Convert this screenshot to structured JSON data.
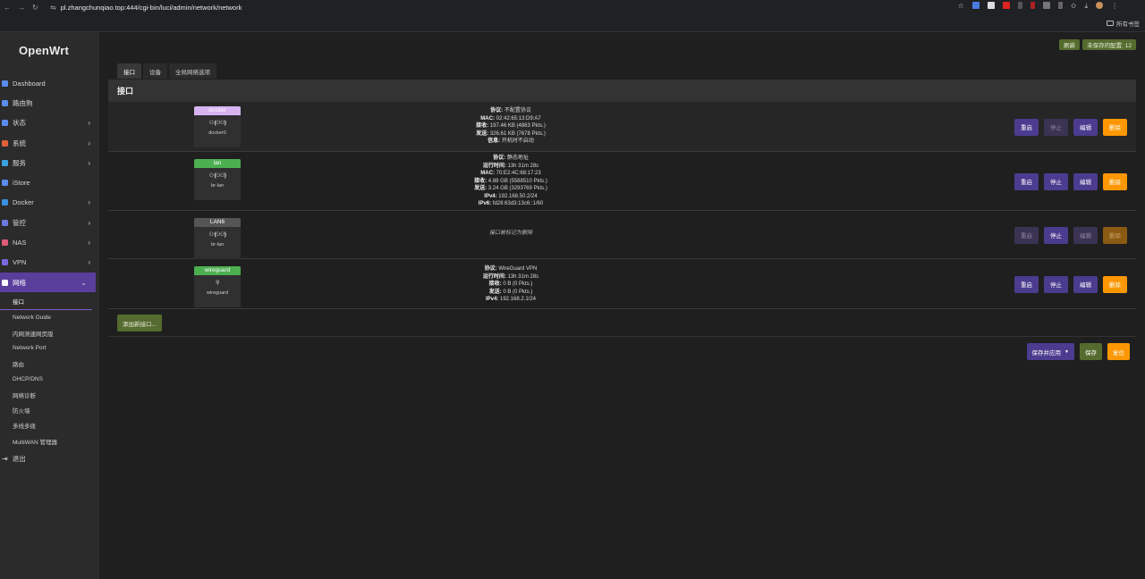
{
  "browser": {
    "url": "pl.zhangchunqiao.top:444/cgi-bin/luci/admin/network/network",
    "all_bookmarks": "所有书签"
  },
  "app": {
    "logo": "OpenWrt"
  },
  "sidebar": {
    "items": [
      {
        "label": "Dashboard",
        "icon": "dashboard-icon",
        "color": "#5b8def",
        "chevron": false
      },
      {
        "label": "路由狗",
        "icon": "dog-icon",
        "color": "#5b8def",
        "chevron": false
      },
      {
        "label": "状态",
        "icon": "status-icon",
        "color": "#5b8def",
        "chevron": true
      },
      {
        "label": "系统",
        "icon": "system-icon",
        "color": "#e0603a",
        "chevron": true
      },
      {
        "label": "服务",
        "icon": "services-icon",
        "color": "#3aa0e0",
        "chevron": true
      },
      {
        "label": "iStore",
        "icon": "store-icon",
        "color": "#5b8def",
        "chevron": false
      },
      {
        "label": "Docker",
        "icon": "docker-icon",
        "color": "#3a90e0",
        "chevron": true
      },
      {
        "label": "管控",
        "icon": "control-icon",
        "color": "#6a7ae0",
        "chevron": true
      },
      {
        "label": "NAS",
        "icon": "nas-icon",
        "color": "#e05a7a",
        "chevron": true
      },
      {
        "label": "VPN",
        "icon": "vpn-icon",
        "color": "#7a6ae0",
        "chevron": true
      },
      {
        "label": "网络",
        "icon": "network-icon",
        "color": "#ffffff",
        "chevron": true
      }
    ],
    "submenu": [
      "接口",
      "Network Guide",
      "内网测速网页版",
      "Network Port",
      "路由",
      "DHCP/DNS",
      "网络诊断",
      "防火墙",
      "多线多拨",
      "MultiWAN 管理器"
    ],
    "logout": "退出"
  },
  "header": {
    "refresh": "刷新",
    "unsaved": "未保存的配置: 12"
  },
  "tabs": [
    "接口",
    "设备",
    "全局网络选项"
  ],
  "section_title": "接口",
  "interfaces": [
    {
      "name": "docker",
      "title_color": "#d7b3f0",
      "device": "docker0",
      "ports": "⁰⁰(ᐩᐩᐩ)",
      "info": [
        {
          "k": "协议:",
          "v": " 不配置协议"
        },
        {
          "k": "MAC:",
          "v": " 02:42:65:13:D9:A7"
        },
        {
          "k": "接收:",
          "v": " 197.46 KB (4863 Pkts.)"
        },
        {
          "k": "发送:",
          "v": " 326.61 KB (7678 Pkts.)"
        },
        {
          "k": "信息:",
          "v": " 开机时不启动"
        }
      ],
      "buttons": [
        "重启",
        "停止",
        "编辑",
        "删除"
      ]
    },
    {
      "name": "lan",
      "title_color": "#4caf50",
      "device": "br-lan",
      "info": [
        {
          "k": "协议:",
          "v": " 静态地址"
        },
        {
          "k": "运行时间:",
          "v": " 13h 31m 28s"
        },
        {
          "k": "MAC:",
          "v": " 70:E2:4C:68:17:23"
        },
        {
          "k": "接收:",
          "v": " 4.88 GB (5588510 Pkts.)"
        },
        {
          "k": "发送:",
          "v": " 3.24 GB (3293769 Pkts.)"
        },
        {
          "k": "IPv4:",
          "v": " 192.168.50.2/24"
        },
        {
          "k": "IPv6:",
          "v": " fd28:63d3:13c6::1/60"
        }
      ],
      "buttons": [
        "重启",
        "停止",
        "编辑",
        "删除"
      ]
    },
    {
      "name": "LAN6",
      "title_color": "#555555",
      "device": "br-lan",
      "note": "接口被标记为删除",
      "buttons": [
        "重启",
        "停止",
        "编辑",
        "删除"
      ]
    },
    {
      "name": "wireguard",
      "title_color": "#4caf50",
      "device": "wireguard",
      "info": [
        {
          "k": "协议:",
          "v": " WireGuard VPN"
        },
        {
          "k": "运行时间:",
          "v": " 13h 31m 28s"
        },
        {
          "k": "接收:",
          "v": " 0 B (0 Pkts.)"
        },
        {
          "k": "发送:",
          "v": " 0 B (0 Pkts.)"
        },
        {
          "k": "IPv4:",
          "v": " 192.168.2.1/24"
        }
      ],
      "buttons": [
        "重启",
        "停止",
        "编辑",
        "删除"
      ]
    }
  ],
  "add_interface": "添加新接口...",
  "footer": {
    "save_apply": "保存并应用",
    "save": "保存",
    "reset": "复位"
  }
}
